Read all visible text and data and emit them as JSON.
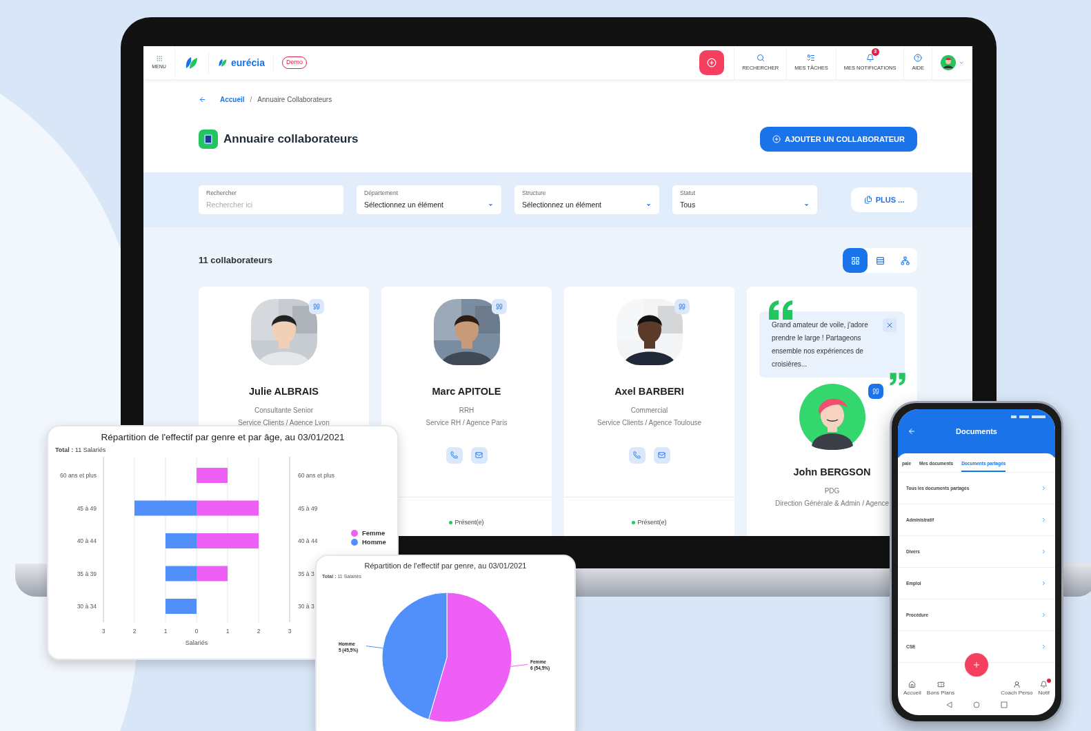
{
  "nav": {
    "menu": "MENU",
    "brand": "eurécia",
    "badge": "Demo",
    "items": [
      {
        "kind": "search",
        "label": "RECHERCHER"
      },
      {
        "kind": "tasks",
        "label": "MES TÂCHES"
      },
      {
        "kind": "bell",
        "label": "MES NOTIFICATIONS",
        "count": "3"
      },
      {
        "kind": "help",
        "label": "AIDE"
      }
    ]
  },
  "breadcrumb": {
    "items": [
      "Accueil",
      "Annuaire Collaborateurs"
    ],
    "separator": "/"
  },
  "page_title": "Annuaire collaborateurs",
  "add_button": "AJOUTER UN COLLABORATEUR",
  "filters": [
    {
      "kind": "text",
      "label": "Rechercher",
      "placeholder": "Rechercher ici"
    },
    {
      "kind": "select",
      "label": "Département",
      "value": "Sélectionnez un élément"
    },
    {
      "kind": "select",
      "label": "Structure",
      "value": "Sélectionnez un élément"
    },
    {
      "kind": "select",
      "label": "Statut",
      "value": "Tous"
    }
  ],
  "more_button": "PLUS ...",
  "count": "11 collaborateurs",
  "views": [
    {
      "kind": "grid",
      "selected": true
    },
    {
      "kind": "list",
      "selected": false
    },
    {
      "kind": "org",
      "selected": false
    }
  ],
  "cards": [
    {
      "kind": "profile",
      "name": "Julie ALBRAIS",
      "role": "Consultante Senior",
      "team": "Service Clients / Agence Lyon",
      "contact": false
    },
    {
      "kind": "profile",
      "name": "Marc APITOLE",
      "role": "RRH",
      "team": "Service RH / Agence Paris",
      "contact": true,
      "status": "Présent(e)",
      "present": true
    },
    {
      "kind": "profile",
      "name": "Axel BARBERI",
      "role": "Commercial",
      "team": "Service Clients / Agence Toulouse",
      "contact": true,
      "status": "Présent(e)",
      "present": true
    },
    {
      "kind": "quote",
      "quote": "Grand amateur de voile, j'adore prendre le large ! Partageons ensemble nos expériences de croisières...",
      "name": "John BERGSON",
      "role": "PDG",
      "team": "Direction Générale & Admin / Agence",
      "contact": false
    }
  ],
  "age_chart": {
    "total": "**Total :** 11 Salariés",
    "right_labels": [
      "60 ans et plus",
      "45 à 49",
      "40 à 44",
      "35 à 3",
      "30 à 3"
    ],
    "chart_data": {
      "type": "bar",
      "orientation": "horizontal",
      "stacked": true,
      "grid": true,
      "legend": "right",
      "title": "Répartition de l'effectif par genre et par âge, au 03/01/2021",
      "xlabel": "Salariés",
      "categories": [
        "60 ans et plus",
        "45 à 49",
        "40 à 44",
        "35 à 39",
        "30 à 34"
      ],
      "series": [
        {
          "name": "Femme",
          "color": "#ee5ff5",
          "values": [
            1,
            2,
            2,
            1,
            0
          ]
        },
        {
          "name": "Homme",
          "color": "#5190fb",
          "values": [
            0,
            -2,
            -1,
            -1,
            -1
          ]
        }
      ],
      "xlim": [
        -3,
        3
      ],
      "xticks": [
        {
          "value": -3,
          "label": "3"
        },
        {
          "value": -2,
          "label": "2"
        },
        {
          "value": -1,
          "label": "1"
        },
        {
          "value": 0,
          "label": "0"
        },
        {
          "value": 1,
          "label": "1"
        },
        {
          "value": 2,
          "label": "2"
        },
        {
          "value": 3,
          "label": "3"
        }
      ]
    }
  },
  "gender_chart": {
    "total": "**Total :** 11 Salariés",
    "chart_data": {
      "type": "pie",
      "title": "Répartition de l'effectif par genre, au 03/01/2021",
      "categories": [
        "Femme",
        "Homme"
      ],
      "values": [
        6,
        5
      ],
      "colors": [
        "#ee5ff5",
        "#5190fb"
      ],
      "data_labels": true,
      "value_labels": [
        "6 (54,5%)",
        "5 (45,5%)"
      ]
    }
  },
  "phone": {
    "title": "Documents",
    "tabs": [
      {
        "label": "paie",
        "selected": false
      },
      {
        "label": "Mes documents",
        "selected": false
      },
      {
        "label": "Documents partagés",
        "selected": true
      }
    ],
    "rows": [
      "Tous les documents partagés",
      "Administratif",
      "Divers",
      "Emploi",
      "Procédure",
      "CSE"
    ],
    "bottom_nav": [
      {
        "kind": "home",
        "label": "Accueil"
      },
      {
        "kind": "deals",
        "label": "Bons Plans"
      },
      {
        "kind": "coach",
        "label": "Coach Perso"
      },
      {
        "kind": "notif",
        "label": "Notif",
        "badge": true
      }
    ]
  }
}
